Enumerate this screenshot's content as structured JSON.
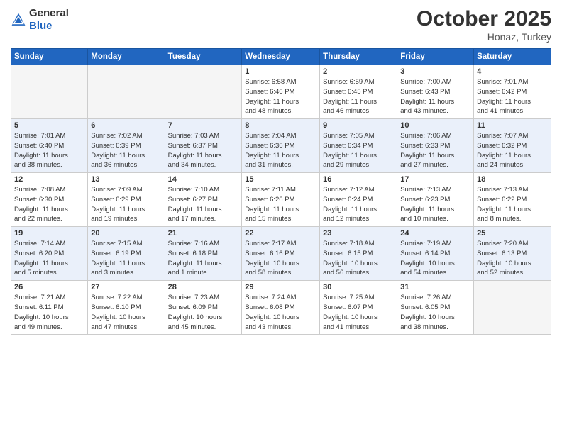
{
  "header": {
    "logo_general": "General",
    "logo_blue": "Blue",
    "month": "October 2025",
    "location": "Honaz, Turkey"
  },
  "weekdays": [
    "Sunday",
    "Monday",
    "Tuesday",
    "Wednesday",
    "Thursday",
    "Friday",
    "Saturday"
  ],
  "weeks": [
    [
      {
        "day": "",
        "info": ""
      },
      {
        "day": "",
        "info": ""
      },
      {
        "day": "",
        "info": ""
      },
      {
        "day": "1",
        "info": "Sunrise: 6:58 AM\nSunset: 6:46 PM\nDaylight: 11 hours\nand 48 minutes."
      },
      {
        "day": "2",
        "info": "Sunrise: 6:59 AM\nSunset: 6:45 PM\nDaylight: 11 hours\nand 46 minutes."
      },
      {
        "day": "3",
        "info": "Sunrise: 7:00 AM\nSunset: 6:43 PM\nDaylight: 11 hours\nand 43 minutes."
      },
      {
        "day": "4",
        "info": "Sunrise: 7:01 AM\nSunset: 6:42 PM\nDaylight: 11 hours\nand 41 minutes."
      }
    ],
    [
      {
        "day": "5",
        "info": "Sunrise: 7:01 AM\nSunset: 6:40 PM\nDaylight: 11 hours\nand 38 minutes."
      },
      {
        "day": "6",
        "info": "Sunrise: 7:02 AM\nSunset: 6:39 PM\nDaylight: 11 hours\nand 36 minutes."
      },
      {
        "day": "7",
        "info": "Sunrise: 7:03 AM\nSunset: 6:37 PM\nDaylight: 11 hours\nand 34 minutes."
      },
      {
        "day": "8",
        "info": "Sunrise: 7:04 AM\nSunset: 6:36 PM\nDaylight: 11 hours\nand 31 minutes."
      },
      {
        "day": "9",
        "info": "Sunrise: 7:05 AM\nSunset: 6:34 PM\nDaylight: 11 hours\nand 29 minutes."
      },
      {
        "day": "10",
        "info": "Sunrise: 7:06 AM\nSunset: 6:33 PM\nDaylight: 11 hours\nand 27 minutes."
      },
      {
        "day": "11",
        "info": "Sunrise: 7:07 AM\nSunset: 6:32 PM\nDaylight: 11 hours\nand 24 minutes."
      }
    ],
    [
      {
        "day": "12",
        "info": "Sunrise: 7:08 AM\nSunset: 6:30 PM\nDaylight: 11 hours\nand 22 minutes."
      },
      {
        "day": "13",
        "info": "Sunrise: 7:09 AM\nSunset: 6:29 PM\nDaylight: 11 hours\nand 19 minutes."
      },
      {
        "day": "14",
        "info": "Sunrise: 7:10 AM\nSunset: 6:27 PM\nDaylight: 11 hours\nand 17 minutes."
      },
      {
        "day": "15",
        "info": "Sunrise: 7:11 AM\nSunset: 6:26 PM\nDaylight: 11 hours\nand 15 minutes."
      },
      {
        "day": "16",
        "info": "Sunrise: 7:12 AM\nSunset: 6:24 PM\nDaylight: 11 hours\nand 12 minutes."
      },
      {
        "day": "17",
        "info": "Sunrise: 7:13 AM\nSunset: 6:23 PM\nDaylight: 11 hours\nand 10 minutes."
      },
      {
        "day": "18",
        "info": "Sunrise: 7:13 AM\nSunset: 6:22 PM\nDaylight: 11 hours\nand 8 minutes."
      }
    ],
    [
      {
        "day": "19",
        "info": "Sunrise: 7:14 AM\nSunset: 6:20 PM\nDaylight: 11 hours\nand 5 minutes."
      },
      {
        "day": "20",
        "info": "Sunrise: 7:15 AM\nSunset: 6:19 PM\nDaylight: 11 hours\nand 3 minutes."
      },
      {
        "day": "21",
        "info": "Sunrise: 7:16 AM\nSunset: 6:18 PM\nDaylight: 11 hours\nand 1 minute."
      },
      {
        "day": "22",
        "info": "Sunrise: 7:17 AM\nSunset: 6:16 PM\nDaylight: 10 hours\nand 58 minutes."
      },
      {
        "day": "23",
        "info": "Sunrise: 7:18 AM\nSunset: 6:15 PM\nDaylight: 10 hours\nand 56 minutes."
      },
      {
        "day": "24",
        "info": "Sunrise: 7:19 AM\nSunset: 6:14 PM\nDaylight: 10 hours\nand 54 minutes."
      },
      {
        "day": "25",
        "info": "Sunrise: 7:20 AM\nSunset: 6:13 PM\nDaylight: 10 hours\nand 52 minutes."
      }
    ],
    [
      {
        "day": "26",
        "info": "Sunrise: 7:21 AM\nSunset: 6:11 PM\nDaylight: 10 hours\nand 49 minutes."
      },
      {
        "day": "27",
        "info": "Sunrise: 7:22 AM\nSunset: 6:10 PM\nDaylight: 10 hours\nand 47 minutes."
      },
      {
        "day": "28",
        "info": "Sunrise: 7:23 AM\nSunset: 6:09 PM\nDaylight: 10 hours\nand 45 minutes."
      },
      {
        "day": "29",
        "info": "Sunrise: 7:24 AM\nSunset: 6:08 PM\nDaylight: 10 hours\nand 43 minutes."
      },
      {
        "day": "30",
        "info": "Sunrise: 7:25 AM\nSunset: 6:07 PM\nDaylight: 10 hours\nand 41 minutes."
      },
      {
        "day": "31",
        "info": "Sunrise: 7:26 AM\nSunset: 6:05 PM\nDaylight: 10 hours\nand 38 minutes."
      },
      {
        "day": "",
        "info": ""
      }
    ]
  ]
}
